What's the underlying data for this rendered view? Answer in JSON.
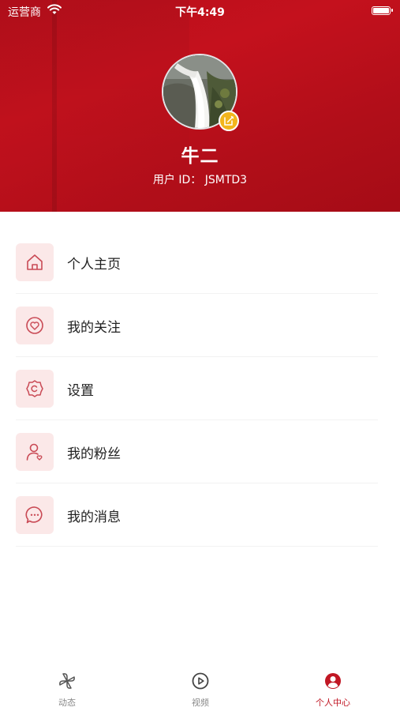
{
  "status_bar": {
    "carrier": "运营商",
    "time": "下午4:49"
  },
  "profile": {
    "name": "牛二",
    "user_id": "用户 ID： JSMTD3"
  },
  "menu": {
    "items": [
      {
        "label": "个人主页",
        "icon": "home-icon"
      },
      {
        "label": "我的关注",
        "icon": "heart-icon"
      },
      {
        "label": "设置",
        "icon": "gear-icon"
      },
      {
        "label": "我的粉丝",
        "icon": "user-heart-icon"
      },
      {
        "label": "我的消息",
        "icon": "chat-icon"
      }
    ]
  },
  "tabbar": {
    "tabs": [
      {
        "label": "动态",
        "icon": "pinwheel-icon",
        "active": false
      },
      {
        "label": "视频",
        "icon": "play-circle-icon",
        "active": false
      },
      {
        "label": "个人中心",
        "icon": "person-circle-icon",
        "active": true
      }
    ]
  },
  "colors": {
    "header_red": "#c4111d",
    "accent_red": "#c11724",
    "icon_bg": "#fbe8e8",
    "edit_badge": "#f2b51c"
  }
}
